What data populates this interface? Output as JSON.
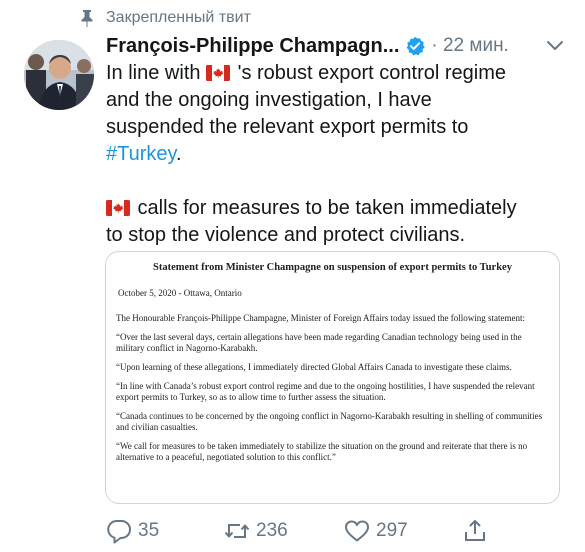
{
  "pinned_label": "Закрепленный твит",
  "author": {
    "name": "François-Philippe Champagn...",
    "time": "· 22 мин."
  },
  "tweet": {
    "line1_a": "In line with ",
    "line1_b": " 's robust export control regime",
    "line2": "and the ongoing investigation, I have",
    "line3": "suspended the relevant export permits to",
    "hashtag": "#Turkey",
    "hashtag_tail": ".",
    "line5_a": " calls for measures to be taken immediately",
    "line6": "to stop the violence and protect civilians."
  },
  "document": {
    "title": "Statement from Minister Champagne on suspension of export permits to Turkey",
    "date": "October 5, 2020 - Ottawa, Ontario",
    "p1": "The Honourable François-Philippe Champagne, Minister of Foreign Affairs today issued the following statement:",
    "p2": "“Over the last several days, certain allegations have been made regarding Canadian technology being used in the military conflict in Nagorno-Karabakh.",
    "p3": "“Upon learning of these allegations, I immediately directed Global Affairs Canada to investigate these claims.",
    "p4": "“In line with Canada’s robust export control regime and due to the ongoing hostilities, I have suspended the relevant export permits to Turkey, so as to allow time to further assess the situation.",
    "p5": "“Canada continues to be concerned by the ongoing conflict in Nagorno-Karabakh resulting in shelling of communities and civilian casualties.",
    "p6": "“We call for measures to be taken immediately to stabilize the situation on the ground and reiterate that there is no alternative to a peaceful, negotiated solution to this conflict.”"
  },
  "actions": {
    "replies": "35",
    "retweets": "236",
    "likes": "297"
  },
  "icons": [
    "pin-icon",
    "verified-badge-icon",
    "chevron-down-icon",
    "canada-flag-icon",
    "reply-icon",
    "retweet-icon",
    "like-icon",
    "share-icon"
  ],
  "colors": {
    "link": "#1b95e0",
    "secondary_text": "#657786",
    "verified": "#1da1f2",
    "flag_red": "#d52b1e"
  }
}
